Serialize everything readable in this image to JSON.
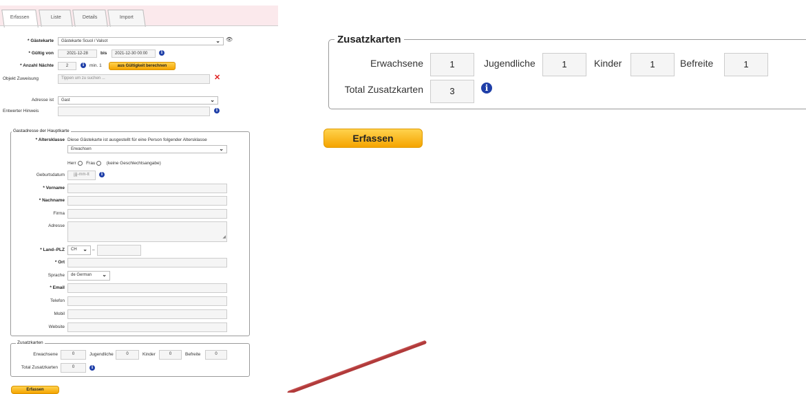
{
  "tabs": [
    "Erfassen",
    "Liste",
    "Details",
    "Import"
  ],
  "form": {
    "gaestekarte_label": "* Gästekarte",
    "gaestekarte_value": "Gästekarte Scuol / Valsot",
    "gueltig_label": "* Gültig von",
    "gueltig_von": "2021-12-28",
    "bis_label": "bis",
    "gueltig_bis": "2021-12-30 00:00",
    "naechte_label": "* Anzahl Nächte",
    "naechte_value": "2",
    "naechte_min": "min. 1",
    "berechnen_button": "aus Gültigkeit berechnen",
    "objekt_label": "Objekt Zuweisung",
    "objekt_placeholder": "Tippen um zu suchen ...",
    "adresse_ist_label": "Adresse ist",
    "adresse_ist_value": "Gast",
    "entwerter_label": "Entwerter Hinweis",
    "entwerter_value": ""
  },
  "gastadresse": {
    "legend": "Gastadresse der Hauptkarte",
    "altersklasse_label": "* Altersklasse",
    "altersklasse_hint": "Diese Gästekarte ist ausgestellt für eine Person folgender Altersklasse",
    "altersklasse_value": "Erwachsen",
    "herr": "Herr",
    "frau": "Frau",
    "keine": "(keine Geschlechtsangabe)",
    "geburtsdatum_label": "Geburtsdatum",
    "geburtsdatum_placeholder": "jjjj-mm-tt",
    "vorname_label": "* Vorname",
    "nachname_label": "* Nachname",
    "firma_label": "Firma",
    "adresse_label": "Adresse",
    "land_plz_label": "* Land–PLZ",
    "land_value": "CH",
    "dash": "–",
    "ort_label": "* Ort",
    "sprache_label": "Sprache",
    "sprache_value": "de German",
    "email_label": "* Email",
    "telefon_label": "Telefon",
    "mobil_label": "Mobil",
    "website_label": "Website"
  },
  "zusatz_small": {
    "legend": "Zusatzkarten",
    "erwachsene_label": "Erwachsene",
    "erwachsene": "0",
    "jugendliche_label": "Jugendliche",
    "jugendliche": "0",
    "kinder_label": "Kinder",
    "kinder": "0",
    "befreite_label": "Befreite",
    "befreite": "0",
    "total_label": "Total Zusatzkarten",
    "total": "0"
  },
  "erfassen_small": "Erfassen",
  "zusatz_large": {
    "legend": "Zusatzkarten",
    "erwachsene_label": "Erwachsene",
    "erwachsene": "1",
    "jugendliche_label": "Jugendliche",
    "jugendliche": "1",
    "kinder_label": "Kinder",
    "kinder": "1",
    "befreite_label": "Befreite",
    "befreite": "1",
    "total_label": "Total Zusatzkarten",
    "total": "3"
  },
  "erfassen_large": "Erfassen",
  "icons": {
    "info": "info-icon",
    "eye": "eye-icon",
    "clear": "close-icon",
    "chevron": "chevron-down-icon",
    "arrow": "annotation-arrow"
  },
  "colors": {
    "accent": "#f5a400",
    "info": "#1f3fa8",
    "clear": "#e02020",
    "arrow": "#b03a3a",
    "tabbar": "#fbe9ec"
  }
}
